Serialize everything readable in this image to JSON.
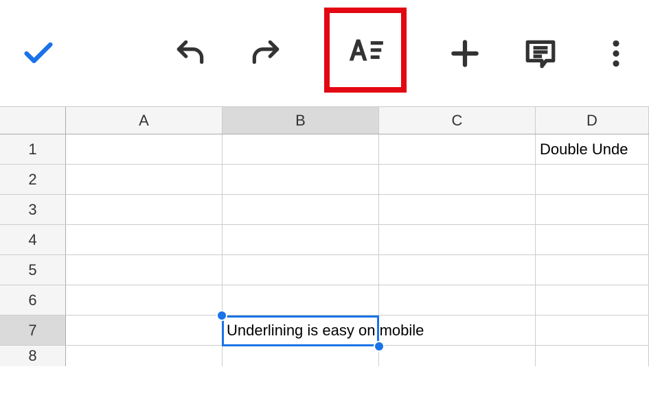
{
  "toolbar": {
    "accept": "accept",
    "undo": "undo",
    "redo": "redo",
    "format": "format",
    "insert": "insert",
    "comment": "comment",
    "more": "more"
  },
  "columns": [
    "A",
    "B",
    "C",
    "D"
  ],
  "rows": [
    "1",
    "2",
    "3",
    "4",
    "5",
    "6",
    "7",
    "8"
  ],
  "cells": {
    "D1": "Double Unde",
    "B7": "Underlining is easy on mobile"
  },
  "selected": {
    "col": "B",
    "row": "7"
  }
}
